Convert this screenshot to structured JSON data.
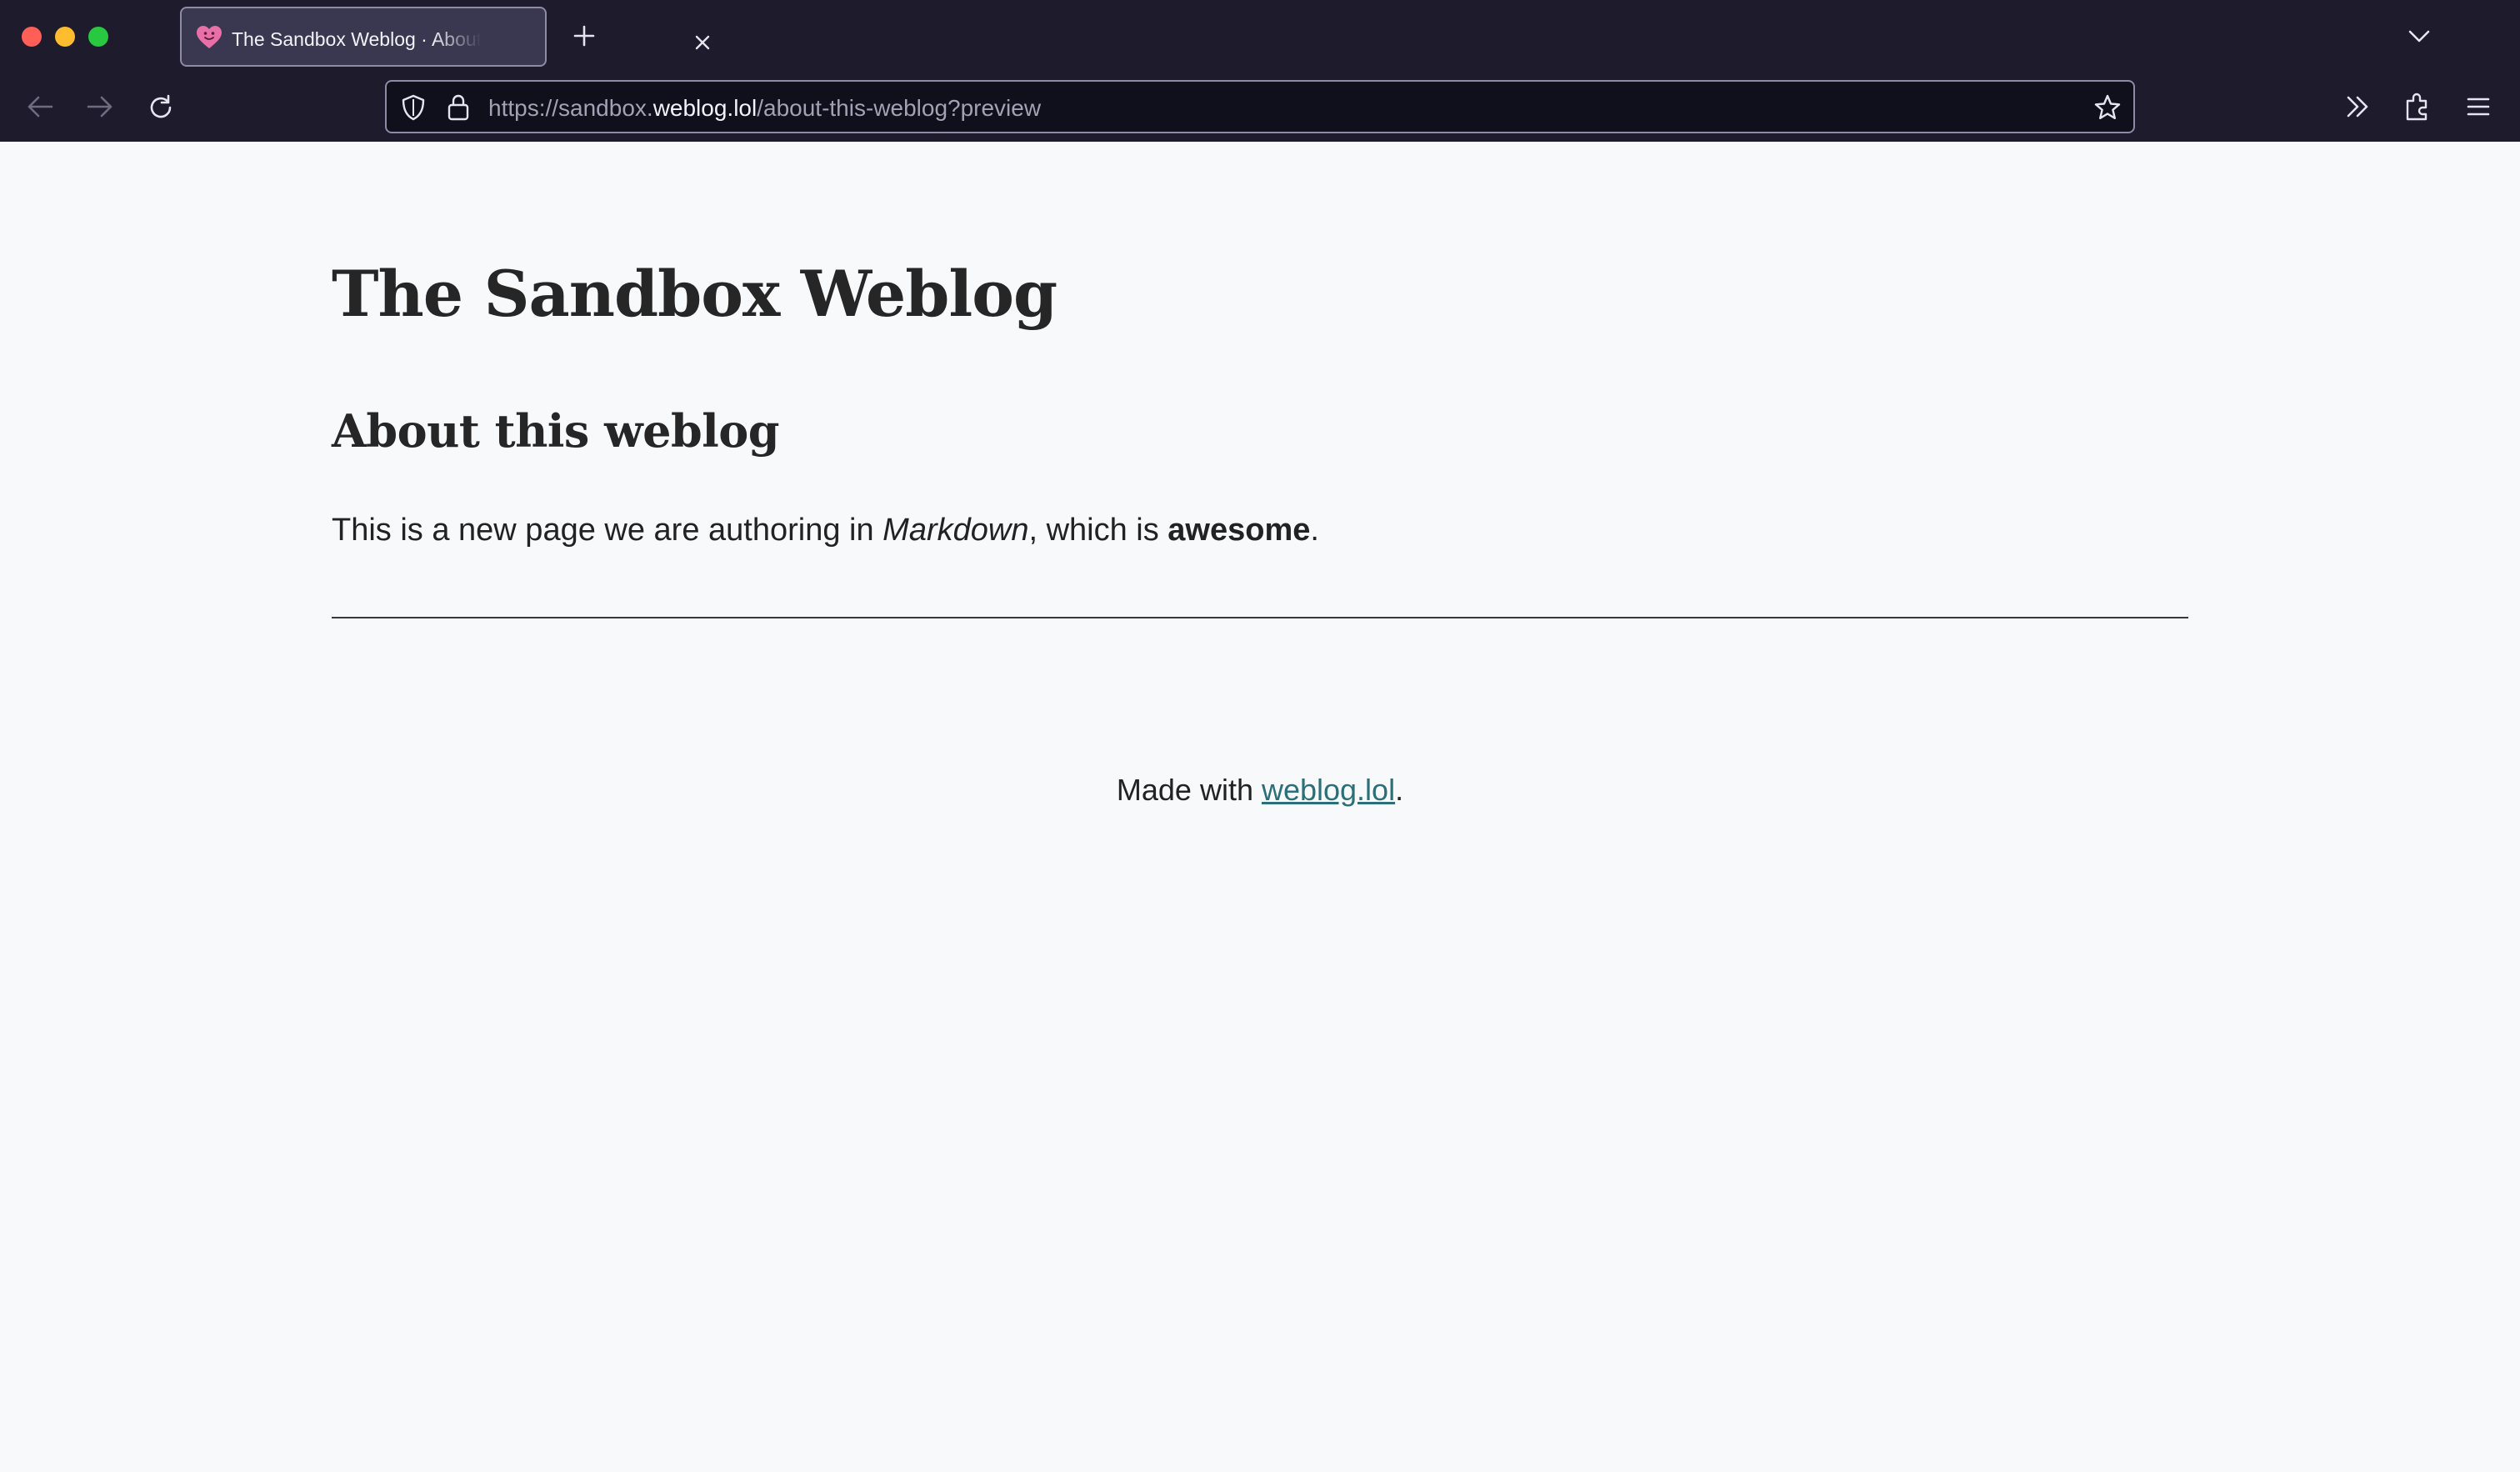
{
  "browser": {
    "tab": {
      "title": "The Sandbox Weblog · About this weblog",
      "favicon": "heart-smiley-icon",
      "close_icon": "close-icon"
    },
    "new_tab_icon": "plus-icon",
    "tab_list_icon": "chevron-down-icon",
    "nav": {
      "back_icon": "back-arrow-icon",
      "forward_icon": "forward-arrow-icon",
      "reload_icon": "reload-icon"
    },
    "url": {
      "prefix": "https://sandbox.",
      "domain": "weblog.lol",
      "path": "/about-this-weblog?preview"
    },
    "toolbar_icons": [
      "shield-icon",
      "lock-icon",
      "star-icon",
      "overflow-chevrons-icon",
      "extensions-icon",
      "hamburger-menu-icon"
    ],
    "colors": {
      "chrome_bg": "#1d1b2c",
      "urlbar_bg": "#100f1c",
      "favicon": "#e86fa8"
    }
  },
  "page": {
    "site_title": "The Sandbox Weblog",
    "heading": "About this weblog",
    "paragraph": {
      "part1": "This is a new page we are authoring in ",
      "emphasis": "Markdown",
      "part2": ", which is ",
      "strong": "awesome",
      "part3": "."
    },
    "footer": {
      "prefix": "Made with ",
      "link_text": "weblog.lol",
      "suffix": "."
    },
    "colors": {
      "background": "#f8f9fb",
      "link": "#2b6f78",
      "text": "#222222"
    }
  }
}
